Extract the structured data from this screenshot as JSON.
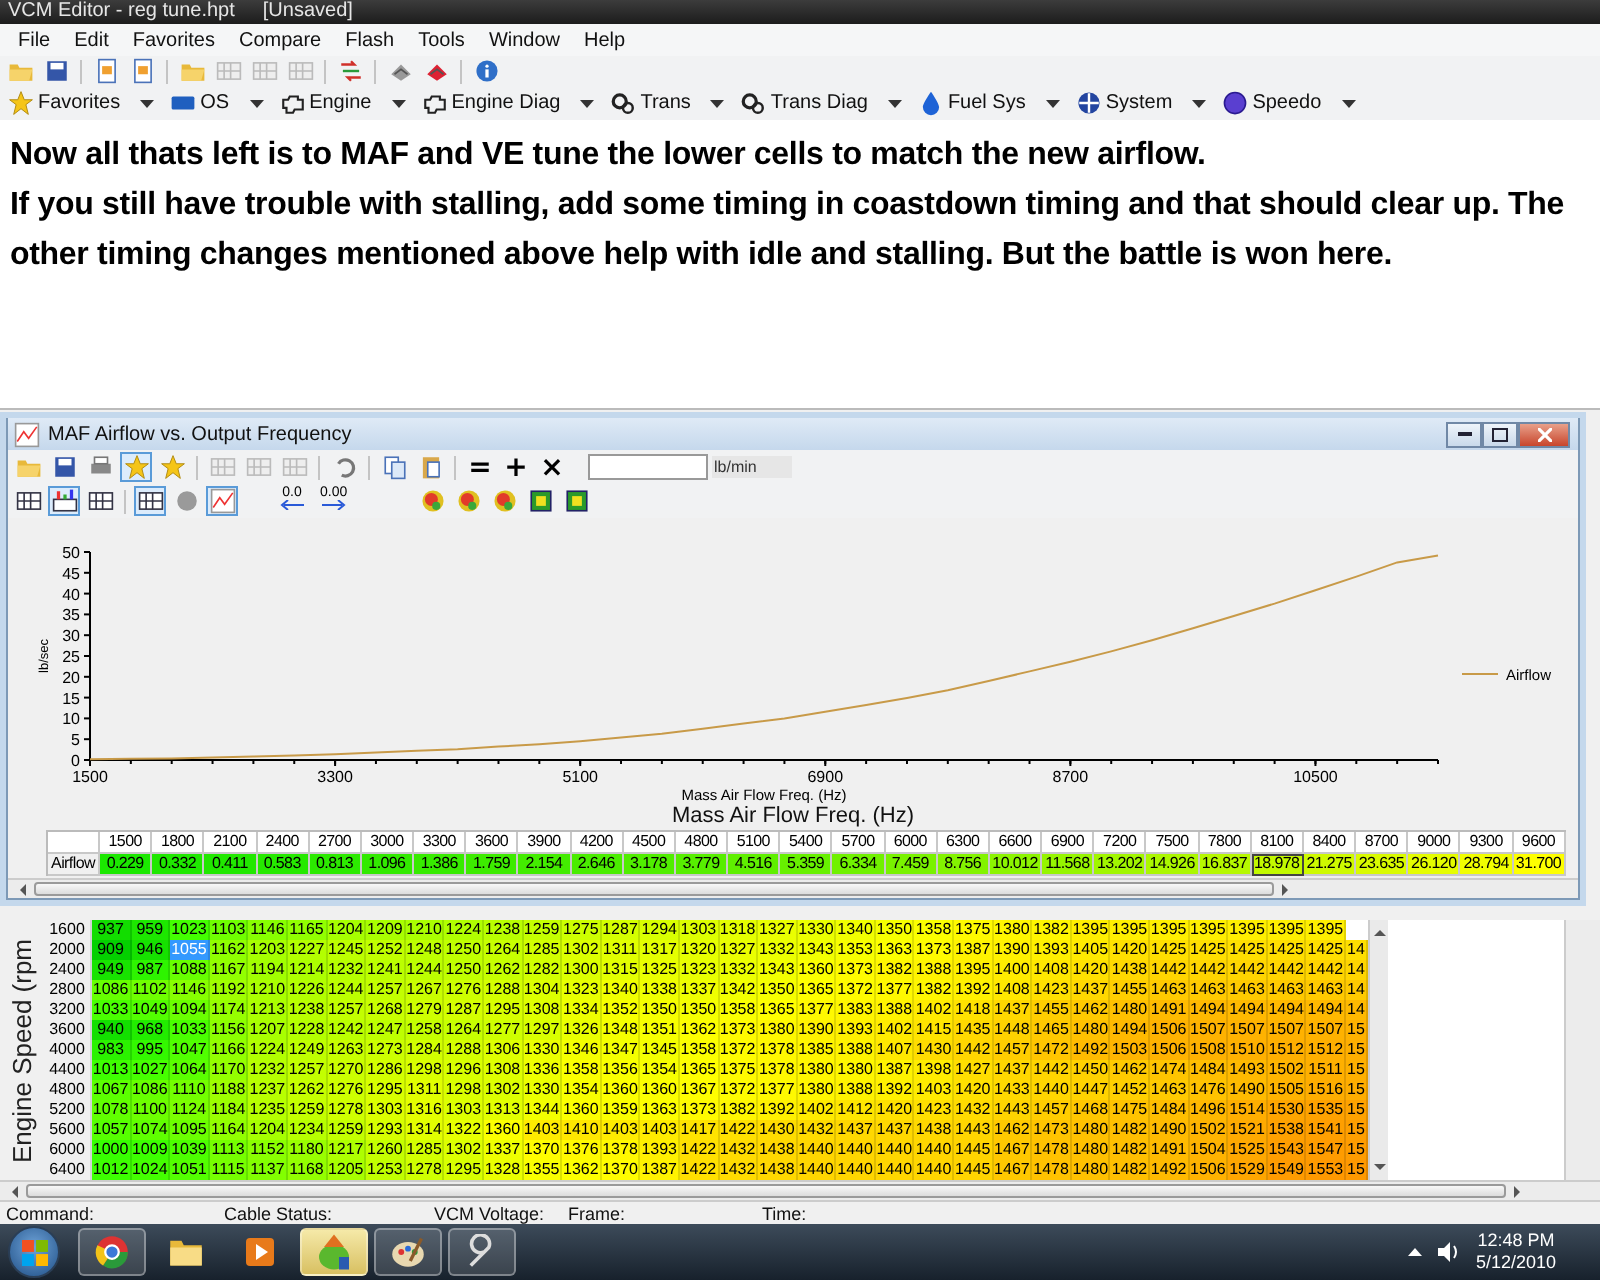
{
  "window": {
    "title": "VCM Editor - reg tune.hpt",
    "status": "[Unsaved]"
  },
  "menu": [
    "File",
    "Edit",
    "Favorites",
    "Compare",
    "Flash",
    "Tools",
    "Window",
    "Help"
  ],
  "nav_menus": [
    {
      "label": "Favorites"
    },
    {
      "label": "OS"
    },
    {
      "label": "Engine"
    },
    {
      "label": "Engine Diag"
    },
    {
      "label": "Trans"
    },
    {
      "label": "Trans Diag"
    },
    {
      "label": "Fuel Sys"
    },
    {
      "label": "System"
    },
    {
      "label": "Speedo"
    }
  ],
  "note": {
    "paragraphs": [
      "Now all thats left is to MAF and VE tune the lower cells to match the new airflow.",
      "If you still have trouble with stalling, add some timing in coastdown timing and that should clear up. The other timing changes mentioned above help with idle and stalling. But the battle is won here."
    ]
  },
  "maf_window": {
    "title": "MAF Airflow vs. Output Frequency",
    "toolbar_1": [
      {
        "pressed": false
      },
      {
        "pressed": false
      },
      {
        "pressed": false
      },
      {
        "pressed": true
      },
      {
        "pressed": false
      },
      {
        "pressed": false
      },
      {
        "pressed": false
      },
      {
        "pressed": false
      },
      {
        "pressed": false
      },
      {
        "pressed": false
      },
      {
        "pressed": false
      }
    ],
    "ops": [
      "=",
      "+",
      "×"
    ],
    "unit": "lb/min",
    "toolbar_2": [
      {
        "pressed": false
      },
      {
        "pressed": true
      },
      {
        "pressed": false
      },
      {
        "pressed": true
      },
      {
        "pressed": false
      },
      {
        "pressed": true
      }
    ],
    "decimal_buttons": [
      "0.0",
      "0.00"
    ],
    "chart_data": {
      "type": "line",
      "xlabel": "Mass Air Flow Freq. (Hz)",
      "ylabel": "lb/sec",
      "x": [
        1500,
        1800,
        2100,
        2400,
        2700,
        3000,
        3300,
        3600,
        3900,
        4200,
        4500,
        4800,
        5100,
        5400,
        5700,
        6000,
        6300,
        6600,
        6900,
        7200,
        7500,
        7800,
        8100,
        8400,
        8700,
        9000,
        9300,
        9600,
        9900,
        10200,
        10500,
        10800,
        11100,
        11400
      ],
      "series": [
        {
          "name": "Airflow",
          "color": "#c89a48",
          "values": [
            0.2,
            0.3,
            0.4,
            0.6,
            0.8,
            1.1,
            1.4,
            1.8,
            2.2,
            2.6,
            3.2,
            3.8,
            4.5,
            5.4,
            6.3,
            7.5,
            8.8,
            10.0,
            11.6,
            13.2,
            14.9,
            16.8,
            19.0,
            21.3,
            23.6,
            26.1,
            28.8,
            31.7,
            34.6,
            37.6,
            40.8,
            44.1,
            47.5,
            49.2
          ]
        }
      ],
      "xlim": [
        1500,
        11400
      ],
      "ylim": [
        0,
        50
      ],
      "xticks": [
        1500,
        3300,
        5100,
        6900,
        8700,
        10500
      ],
      "yticks": [
        0,
        5,
        10,
        15,
        20,
        25,
        30,
        35,
        40,
        45,
        50
      ]
    },
    "table": {
      "title": "Mass Air Flow Freq. (Hz)",
      "row_label": "Airflow",
      "columns": [
        "1500",
        "1800",
        "2100",
        "2400",
        "2700",
        "3000",
        "3300",
        "3600",
        "3900",
        "4200",
        "4500",
        "4800",
        "5100",
        "5400",
        "5700",
        "6000",
        "6300",
        "6600",
        "6900",
        "7200",
        "7500",
        "7800",
        "8100",
        "8400",
        "8700",
        "9000",
        "9300",
        "9600"
      ],
      "cells": [
        "0.229",
        "0.332",
        "0.411",
        "0.583",
        "0.813",
        "1.096",
        "1.386",
        "1.759",
        "2.154",
        "2.646",
        "3.178",
        "3.779",
        "4.516",
        "5.359",
        "6.334",
        "7.459",
        "8.756",
        "10.012",
        "11.568",
        "13.202",
        "14.926",
        "16.837",
        {
          "text": "18.978",
          "selected": true
        },
        "21.275",
        "23.635",
        "26.120",
        "28.794",
        "31.700"
      ]
    }
  },
  "background_table": {
    "axis_label": "Engine Speed (rpm",
    "rows": [
      {
        "label": "1600",
        "cells": [
          "937",
          "959",
          "1023",
          "1103",
          "1146",
          "1165",
          "1204",
          "1209",
          "1210",
          "1224",
          "1238",
          "1259",
          "1275",
          "1287",
          "1294",
          "1303",
          "1318",
          "1327",
          "1330",
          "1340",
          "1350",
          "1358",
          "1375",
          "1380",
          "1382",
          "1395",
          "1395",
          "1395",
          "1395",
          "1395",
          "1395",
          "1395"
        ]
      },
      {
        "label": "2000",
        "cells": [
          "909",
          "946",
          {
            "text": "1055",
            "selected": true
          },
          "1162",
          "1203",
          "1227",
          "1245",
          "1252",
          "1248",
          "1250",
          "1264",
          "1285",
          "1302",
          "1311",
          "1317",
          "1320",
          "1327",
          "1332",
          "1343",
          "1353",
          "1363",
          "1373",
          "1387",
          "1390",
          "1393",
          "1405",
          "1420",
          "1425",
          "1425",
          "1425",
          "1425",
          "1425",
          "14"
        ]
      },
      {
        "label": "2400",
        "cells": [
          "949",
          "987",
          "1088",
          "1167",
          "1194",
          "1214",
          "1232",
          "1241",
          "1244",
          "1250",
          "1262",
          "1282",
          "1300",
          "1315",
          "1325",
          "1323",
          "1332",
          "1343",
          "1360",
          "1373",
          "1382",
          "1388",
          "1395",
          "1400",
          "1408",
          "1420",
          "1438",
          "1442",
          "1442",
          "1442",
          "1442",
          "1442",
          "14"
        ]
      },
      {
        "label": "2800",
        "cells": [
          "1086",
          "1102",
          "1146",
          "1192",
          "1210",
          "1226",
          "1244",
          "1257",
          "1267",
          "1276",
          "1288",
          "1304",
          "1323",
          "1340",
          "1338",
          "1337",
          "1342",
          "1350",
          "1365",
          "1372",
          "1377",
          "1382",
          "1392",
          "1408",
          "1423",
          "1437",
          "1455",
          "1463",
          "1463",
          "1463",
          "1463",
          "1463",
          "14"
        ]
      },
      {
        "label": "3200",
        "cells": [
          "1033",
          "1049",
          "1094",
          "1174",
          "1213",
          "1238",
          "1257",
          "1268",
          "1279",
          "1287",
          "1295",
          "1308",
          "1334",
          "1352",
          "1350",
          "1350",
          "1358",
          "1365",
          "1377",
          "1383",
          "1388",
          "1402",
          "1418",
          "1437",
          "1455",
          "1462",
          "1480",
          "1491",
          "1494",
          "1494",
          "1494",
          "1494",
          "14"
        ]
      },
      {
        "label": "3600",
        "cells": [
          "940",
          "968",
          "1033",
          "1156",
          "1207",
          "1228",
          "1242",
          "1247",
          "1258",
          "1264",
          "1277",
          "1297",
          "1326",
          "1348",
          "1351",
          "1362",
          "1373",
          "1380",
          "1390",
          "1393",
          "1402",
          "1415",
          "1435",
          "1448",
          "1465",
          "1480",
          "1494",
          "1506",
          "1507",
          "1507",
          "1507",
          "1507",
          "15"
        ]
      },
      {
        "label": "4000",
        "cells": [
          "983",
          "995",
          "1047",
          "1166",
          "1224",
          "1249",
          "1263",
          "1273",
          "1284",
          "1288",
          "1306",
          "1330",
          "1346",
          "1347",
          "1345",
          "1358",
          "1372",
          "1378",
          "1385",
          "1388",
          "1407",
          "1430",
          "1442",
          "1457",
          "1472",
          "1492",
          "1503",
          "1506",
          "1508",
          "1510",
          "1512",
          "1512",
          "15"
        ]
      },
      {
        "label": "4400",
        "cells": [
          "1013",
          "1027",
          "1064",
          "1170",
          "1232",
          "1257",
          "1270",
          "1286",
          "1298",
          "1296",
          "1308",
          "1336",
          "1358",
          "1356",
          "1354",
          "1365",
          "1375",
          "1378",
          "1380",
          "1380",
          "1387",
          "1398",
          "1427",
          "1437",
          "1442",
          "1450",
          "1462",
          "1474",
          "1484",
          "1493",
          "1502",
          "1511",
          "15"
        ]
      },
      {
        "label": "4800",
        "cells": [
          "1067",
          "1086",
          "1110",
          "1188",
          "1237",
          "1262",
          "1276",
          "1295",
          "1311",
          "1298",
          "1302",
          "1330",
          "1354",
          "1360",
          "1360",
          "1367",
          "1372",
          "1377",
          "1380",
          "1388",
          "1392",
          "1403",
          "1420",
          "1433",
          "1440",
          "1447",
          "1452",
          "1463",
          "1476",
          "1490",
          "1505",
          "1516",
          "15"
        ]
      },
      {
        "label": "5200",
        "cells": [
          "1078",
          "1100",
          "1124",
          "1184",
          "1235",
          "1259",
          "1278",
          "1303",
          "1316",
          "1303",
          "1313",
          "1344",
          "1360",
          "1359",
          "1363",
          "1373",
          "1382",
          "1392",
          "1402",
          "1412",
          "1420",
          "1423",
          "1432",
          "1443",
          "1457",
          "1468",
          "1475",
          "1484",
          "1496",
          "1514",
          "1530",
          "1535",
          "15"
        ]
      },
      {
        "label": "5600",
        "cells": [
          "1057",
          "1074",
          "1095",
          "1164",
          "1204",
          "1234",
          "1259",
          "1293",
          "1314",
          "1322",
          "1360",
          "1403",
          "1410",
          "1403",
          "1403",
          "1417",
          "1422",
          "1430",
          "1432",
          "1437",
          "1437",
          "1438",
          "1443",
          "1462",
          "1473",
          "1480",
          "1482",
          "1490",
          "1502",
          "1521",
          "1538",
          "1541",
          "15"
        ]
      },
      {
        "label": "6000",
        "cells": [
          "1000",
          "1009",
          "1039",
          "1113",
          "1152",
          "1180",
          "1217",
          "1260",
          "1285",
          "1302",
          "1337",
          "1370",
          "1376",
          "1378",
          "1393",
          "1422",
          "1432",
          "1438",
          "1440",
          "1440",
          "1440",
          "1440",
          "1445",
          "1467",
          "1478",
          "1480",
          "1482",
          "1491",
          "1504",
          "1525",
          "1543",
          "1547",
          "15"
        ]
      },
      {
        "label": "6400",
        "cells": [
          "1012",
          "1024",
          "1051",
          "1115",
          "1137",
          "1168",
          "1205",
          "1253",
          "1278",
          "1295",
          "1328",
          "1355",
          "1362",
          "1370",
          "1387",
          "1422",
          "1432",
          "1438",
          "1440",
          "1440",
          "1440",
          "1440",
          "1445",
          "1467",
          "1478",
          "1480",
          "1482",
          "1492",
          "1506",
          "1529",
          "1549",
          "1553",
          "15"
        ]
      }
    ]
  },
  "status_bar": [
    "Command:",
    "Cable Status:",
    "VCM Voltage:",
    "Frame:",
    "Time:"
  ],
  "taskbar": {
    "apps": [
      {
        "open": true,
        "active": false
      },
      {
        "open": false,
        "active": false
      },
      {
        "open": false,
        "active": false
      },
      {
        "open": true,
        "active": true
      },
      {
        "open": true,
        "active": false
      },
      {
        "open": true,
        "active": false
      }
    ],
    "time": "12:48 PM",
    "date": "5/12/2010"
  }
}
